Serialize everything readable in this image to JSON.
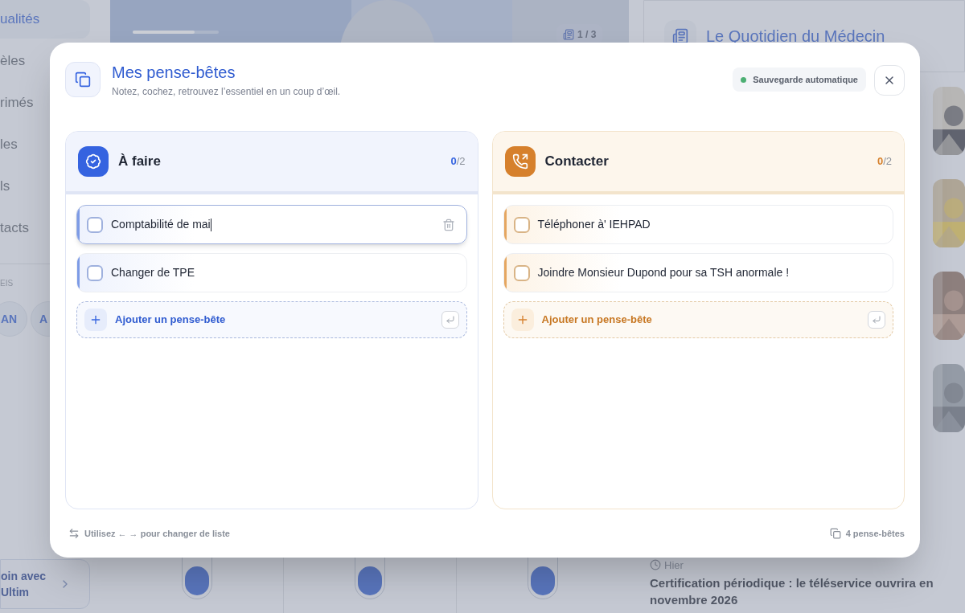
{
  "background": {
    "sidebar": {
      "items": [
        {
          "label": "ualités",
          "selected": true
        },
        {
          "label": "èles",
          "selected": false
        },
        {
          "label": "rimés",
          "selected": false
        },
        {
          "label": "les",
          "selected": false
        },
        {
          "label": "ls",
          "selected": false
        },
        {
          "label": "tacts",
          "selected": false
        }
      ],
      "section_label": "EIS",
      "avatars": [
        "AN",
        "A"
      ],
      "promo": "oin avec Ultim"
    },
    "carousel": {
      "level": 0.72,
      "counter": "1 / 3"
    },
    "news": {
      "title": "Le Quotidien du Médecin",
      "time": "Hier",
      "headline": "Certification périodique : le téléservice ouvrira en novembre 2026"
    }
  },
  "modal": {
    "title": "Mes pense-bêtes",
    "subtitle": "Notez, cochez, retrouvez l’essentiel en un coup d’œil.",
    "autosave": "Sauvegarde automatique",
    "lists": [
      {
        "kind": "todo",
        "title": "À faire",
        "done": "0",
        "total": "/2",
        "add_label": "Ajouter un pense-bête",
        "items": [
          {
            "text": "Comptabilité de mai",
            "checked": false,
            "editing": true
          },
          {
            "text": "Changer de TPE",
            "checked": false,
            "editing": false
          }
        ]
      },
      {
        "kind": "contact",
        "title": "Contacter",
        "done": "0",
        "total": "/2",
        "add_label": "Ajouter un pense-bête",
        "items": [
          {
            "text": "Téléphoner à' IEHPAD",
            "checked": false,
            "editing": false
          },
          {
            "text": "Joindre Monsieur Dupond pour sa TSH anormale !",
            "checked": false,
            "editing": false
          }
        ]
      }
    ],
    "footer_hint": "Utilisez ← → pour changer de liste",
    "footer_count": "4 pense-bêtes"
  }
}
